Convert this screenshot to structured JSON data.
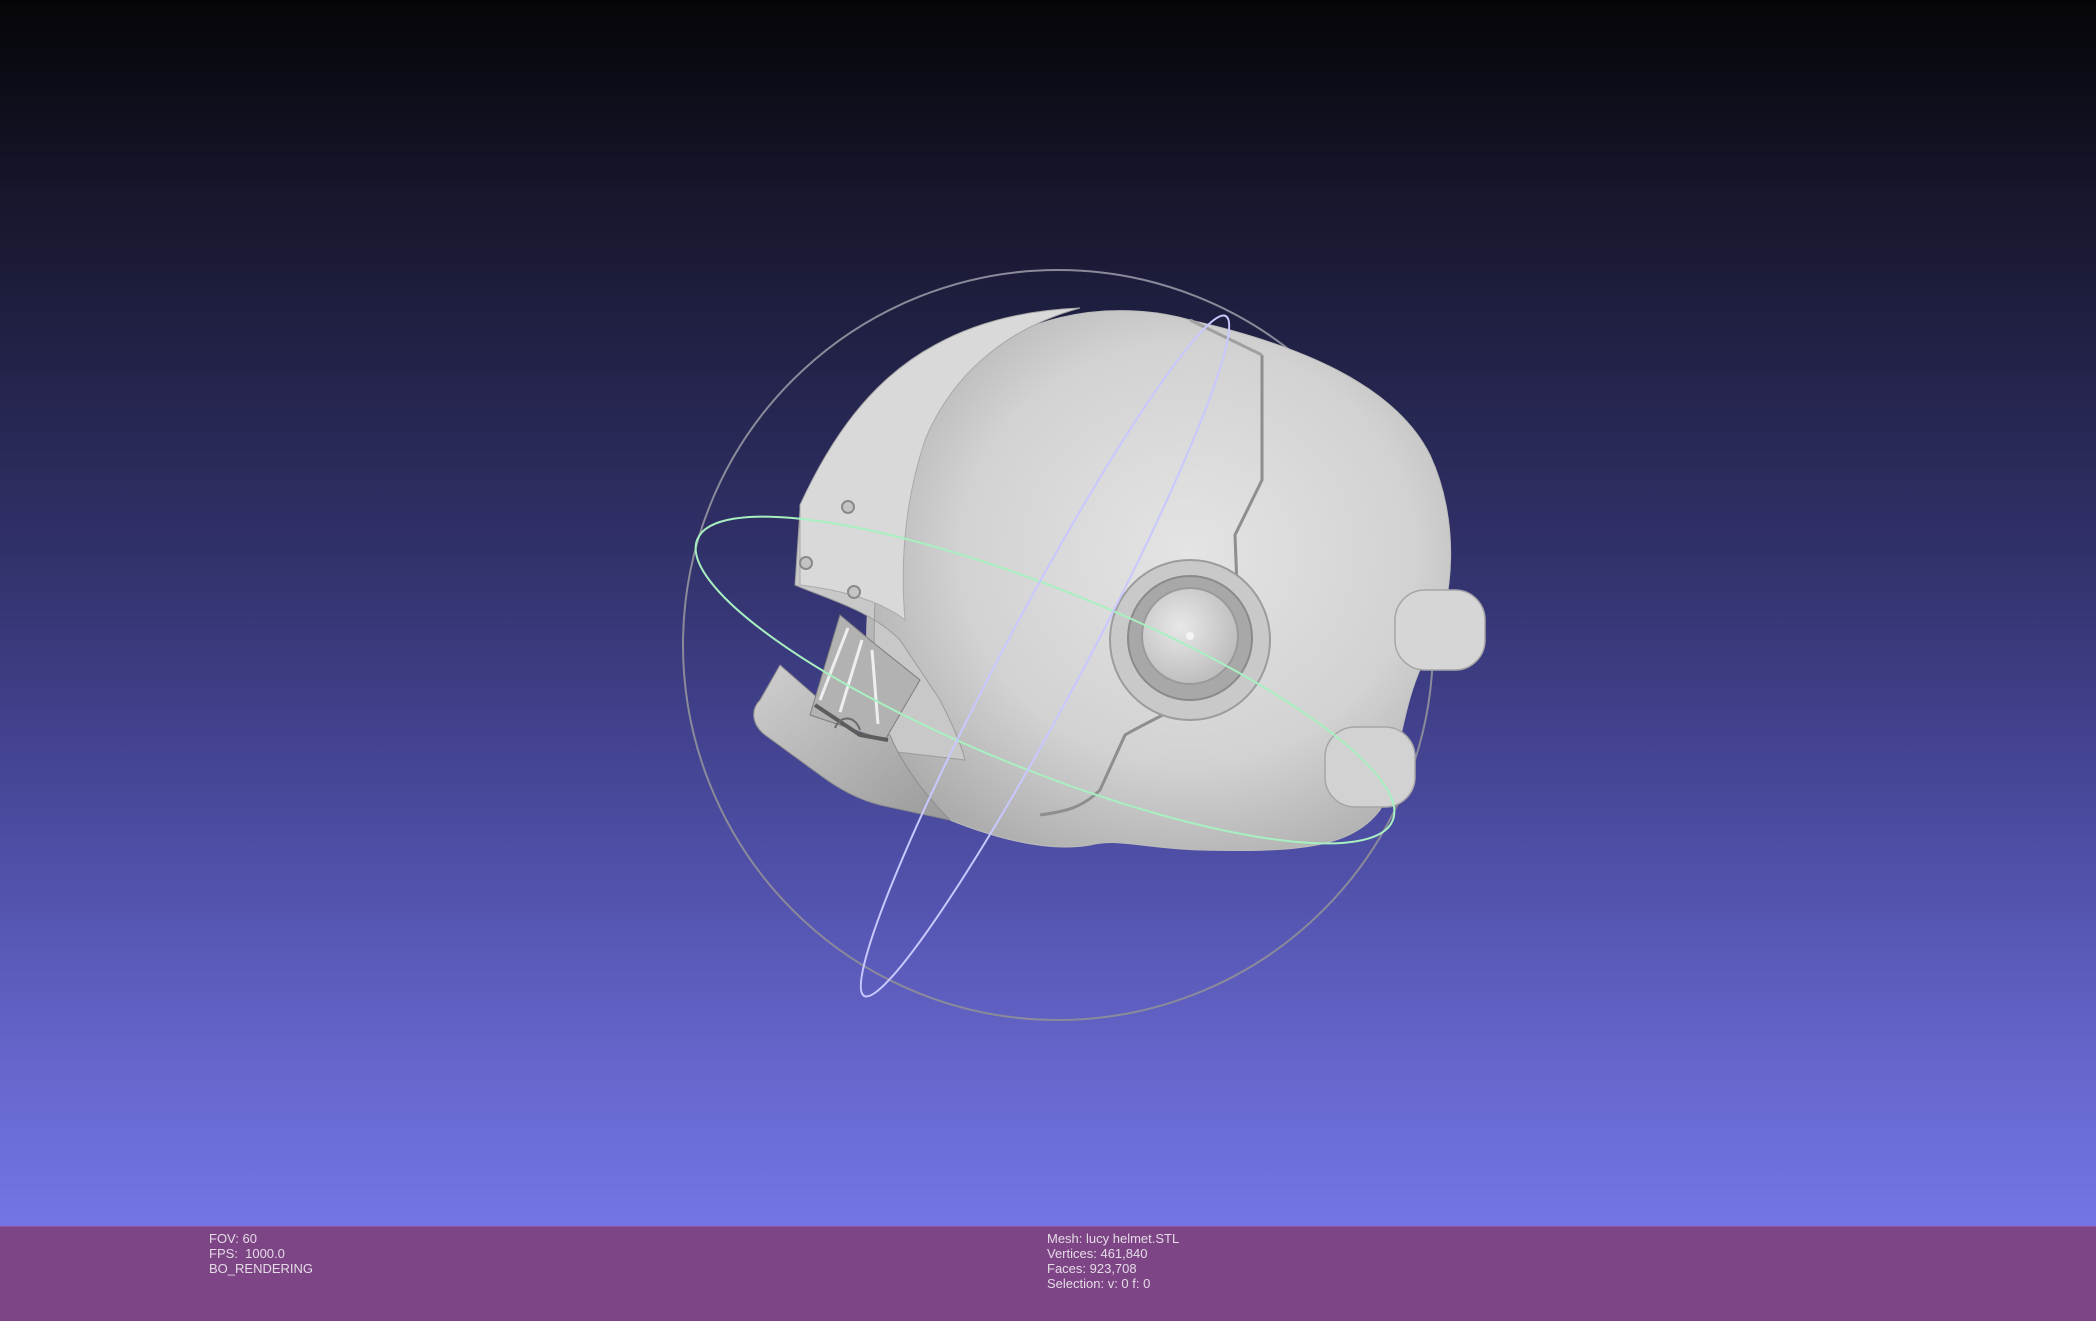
{
  "viewport": {
    "background_top": "#050508",
    "background_bottom": "#7474e6",
    "mesh_color": "#d6d6d6",
    "trackball_colors": {
      "horizontal_ring": "#a8f0c0",
      "vertical_ring": "#c8c8ff",
      "outer_ring": "#8a8a9a"
    }
  },
  "status": {
    "background": "#7d4585",
    "left": {
      "fov": "FOV: 60",
      "fps": "FPS:  1000.0",
      "mode": "BO_RENDERING"
    },
    "right": {
      "mesh": "Mesh: lucy helmet.STL",
      "vertices": "Vertices: 461,840",
      "faces": "Faces: 923,708",
      "selection": "Selection: v: 0 f: 0"
    }
  }
}
